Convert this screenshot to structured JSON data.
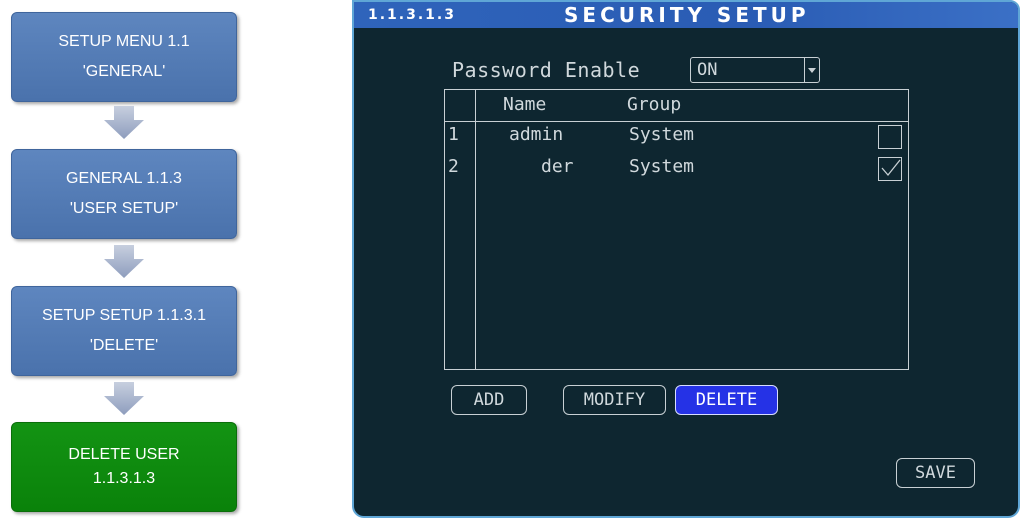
{
  "flow": {
    "steps": [
      {
        "line1": "SETUP MENU 1.1",
        "line2": "'GENERAL'"
      },
      {
        "line1": "GENERAL 1.1.3",
        "line2": "'USER SETUP'"
      },
      {
        "line1": "SETUP SETUP 1.1.3.1",
        "line2": "'DELETE'"
      },
      {
        "line1": "DELETE USER",
        "line2": "1.1.3.1.3"
      }
    ],
    "colors": {
      "step": "#4f78b3",
      "final": "#0b8a0b",
      "arrow": "#9aa8c6"
    }
  },
  "screen": {
    "menu_number": "1.1.3.1.3",
    "title": "SECURITY SETUP",
    "password": {
      "label": "Password Enable",
      "value": "ON"
    },
    "table": {
      "headers": {
        "name": "Name",
        "group": "Group"
      },
      "rows": [
        {
          "index": "1",
          "name": "admin",
          "group": "System",
          "checked": false
        },
        {
          "index": "2",
          "name": "der",
          "group": "System",
          "checked": true
        }
      ]
    },
    "buttons": {
      "add": "ADD",
      "modify": "MODIFY",
      "delete": "DELETE",
      "save": "SAVE"
    },
    "colors": {
      "background": "#0e2630",
      "titlebar": "#2f64bb",
      "active_button": "#2532e6",
      "border": "#5fa6d6"
    }
  }
}
